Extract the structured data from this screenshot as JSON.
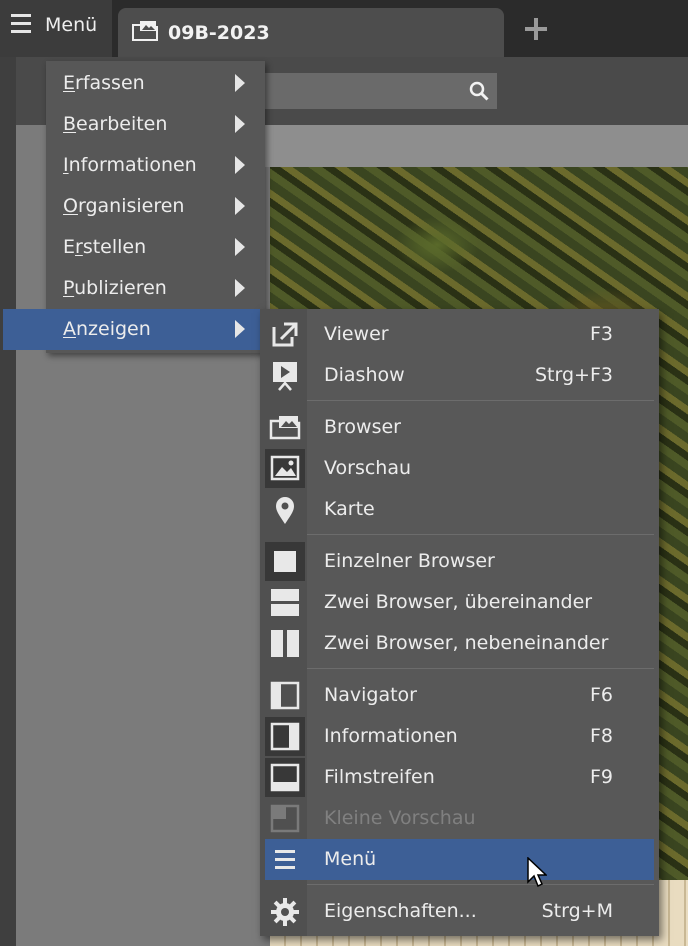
{
  "topbar": {
    "menu_label": "Menü",
    "tab_label": "09B-2023",
    "hamburger_icon": "hamburger-icon",
    "tab_icon": "folder-images-icon",
    "add_tab_icon": "plus-icon"
  },
  "search": {
    "icon": "search-icon"
  },
  "main_menu": {
    "items": [
      {
        "accel": "E",
        "rest": "rfassen"
      },
      {
        "accel": "B",
        "rest": "earbeiten"
      },
      {
        "accel": "I",
        "rest": "nformationen"
      },
      {
        "accel": "O",
        "rest": "rganisieren"
      },
      {
        "pre": "E",
        "accel": "r",
        "rest": "stellen"
      },
      {
        "accel": "P",
        "rest": "ublizieren"
      },
      {
        "accel": "A",
        "rest": "nzeigen"
      }
    ],
    "selected": "Anzeigen"
  },
  "submenu": {
    "items": [
      {
        "label": "Viewer",
        "shortcut": "F3",
        "icon": "external-window-icon"
      },
      {
        "label": "Diashow",
        "shortcut": "Strg+F3",
        "icon": "slideshow-icon"
      },
      {
        "label": "Browser",
        "shortcut": "",
        "icon": "folder-images-icon"
      },
      {
        "label": "Vorschau",
        "shortcut": "",
        "icon": "image-preview-icon"
      },
      {
        "label": "Karte",
        "shortcut": "",
        "icon": "map-pin-icon"
      },
      {
        "label": "Einzelner Browser",
        "shortcut": "",
        "icon": "single-pane-icon"
      },
      {
        "label": "Zwei Browser, übereinander",
        "shortcut": "",
        "icon": "split-horizontal-icon"
      },
      {
        "label": "Zwei Browser, nebeneinander",
        "shortcut": "",
        "icon": "split-vertical-icon"
      },
      {
        "label": "Navigator",
        "shortcut": "F6",
        "icon": "navigator-panel-icon"
      },
      {
        "label": "Informationen",
        "shortcut": "F8",
        "icon": "info-panel-icon"
      },
      {
        "label": "Filmstreifen",
        "shortcut": "F9",
        "icon": "filmstrip-panel-icon"
      },
      {
        "label": "Kleine Vorschau",
        "shortcut": "",
        "icon": "small-preview-icon",
        "disabled": true
      },
      {
        "label": "Menü",
        "shortcut": "",
        "icon": "hamburger-icon",
        "highlighted": true
      },
      {
        "label": "Eigenschaften...",
        "shortcut": "Strg+M",
        "icon": "gear-icon"
      }
    ]
  },
  "colors": {
    "accent": "#3d5f96",
    "menu_bg": "#575757",
    "topbar_bg": "#2b2b2b"
  }
}
